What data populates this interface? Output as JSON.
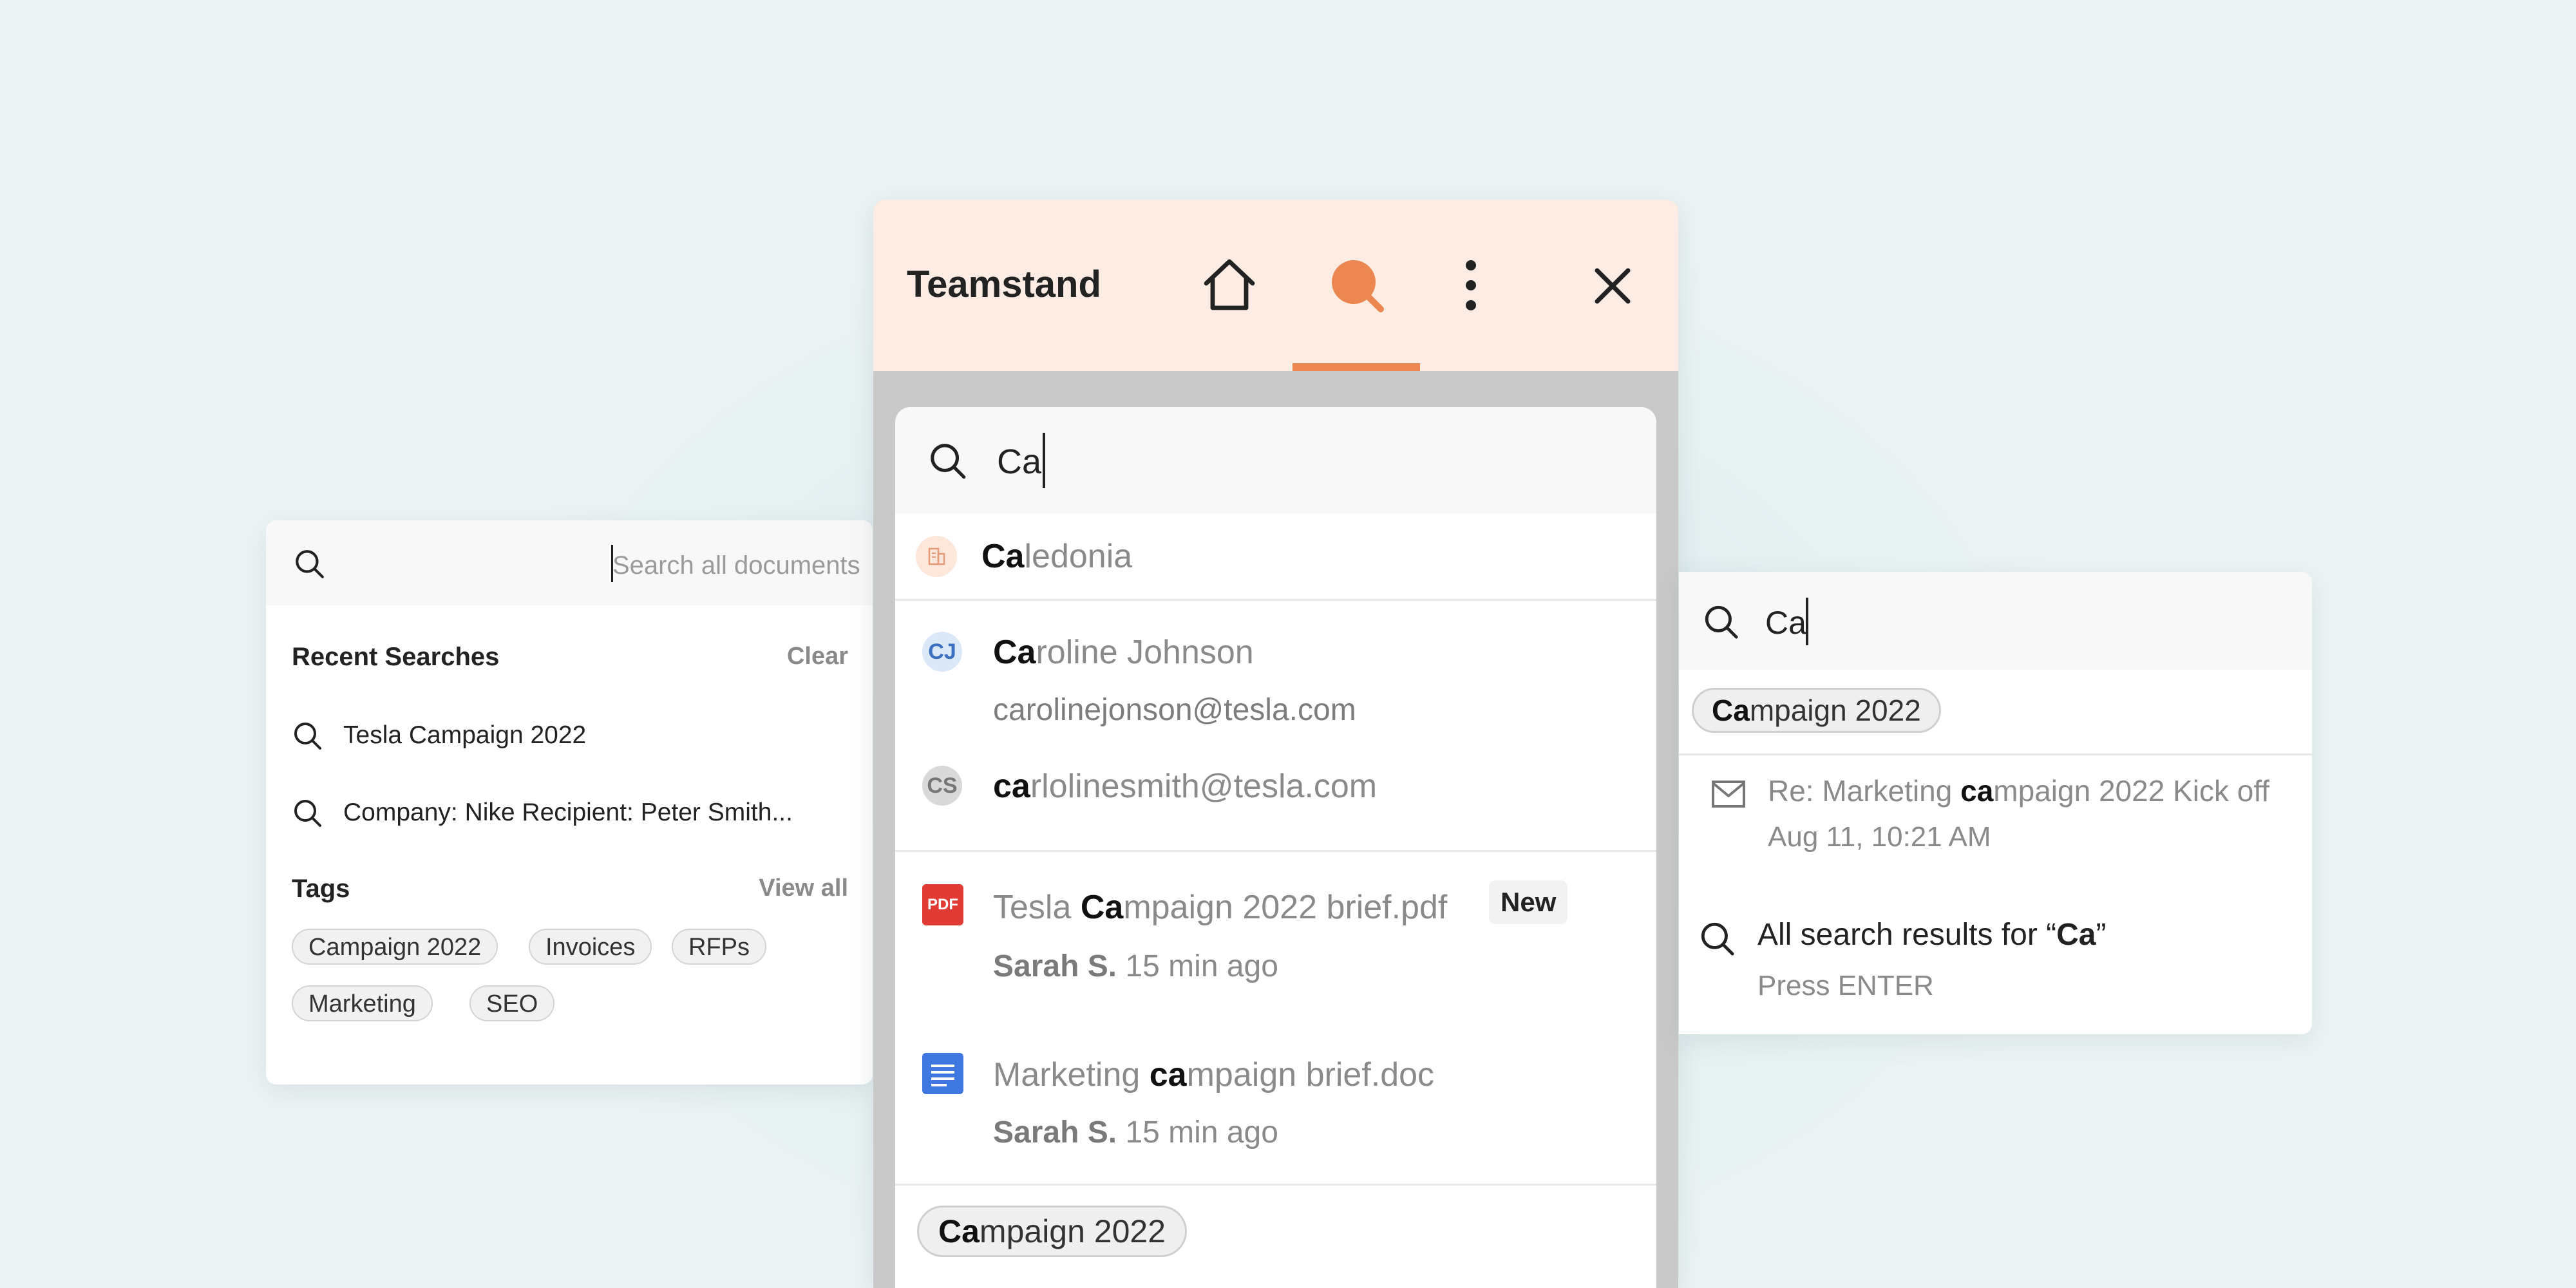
{
  "left_panel": {
    "search_placeholder": "Search all documents",
    "recent_title": "Recent Searches",
    "clear_label": "Clear",
    "recent_items": [
      {
        "icon": "search-icon",
        "text": "Tesla Campaign 2022"
      },
      {
        "icon": "search-icon",
        "text": "Company: Nike Recipient: Peter Smith..."
      }
    ],
    "tags_title": "Tags",
    "view_all_label": "View all",
    "tags": [
      "Campaign 2022",
      "Invoices",
      "RFPs",
      "Marketing",
      "SEO"
    ]
  },
  "main_panel": {
    "app_title": "Teamstand",
    "nav_icons": [
      "home-icon",
      "search-icon",
      "more-vertical-icon",
      "close-icon"
    ],
    "active_tab": "search",
    "search_query": "Ca",
    "results": {
      "company": {
        "match": "Ca",
        "rest": "ledonia",
        "icon": "building-icon"
      },
      "person_1": {
        "initials": "CJ",
        "match": "Ca",
        "rest": "roline Johnson",
        "email": "carolinejonson@tesla.com"
      },
      "person_2": {
        "initials": "CS",
        "match": "ca",
        "rest": "rlolinesmith@tesla.com"
      },
      "file_1": {
        "icon": "pdf-icon",
        "icon_label": "PDF",
        "prefix": "Tesla ",
        "match": "Ca",
        "rest": "mpaign 2022 brief.pdf",
        "badge": "New",
        "author": "Sarah S.",
        "time": "15 min ago"
      },
      "file_2": {
        "icon": "doc-icon",
        "prefix": "Marketing ",
        "match": "ca",
        "rest": "mpaign brief.doc",
        "author": "Sarah S.",
        "time": "15 min ago"
      },
      "tag": {
        "match": "Ca",
        "rest": "mpaign 2022"
      }
    },
    "colors": {
      "accent": "#ec8752",
      "header_bg": "#fcece3"
    }
  },
  "right_panel": {
    "search_query": "Ca",
    "tag": {
      "match": "Ca",
      "rest": "mpaign 2022"
    },
    "email": {
      "icon": "mail-icon",
      "prefix": "Re: Marketing ",
      "match": "ca",
      "rest": "mpaign 2022 Kick off",
      "date": "Aug 11, 10:21 AM"
    },
    "all_results": {
      "icon": "search-icon",
      "prefix": "All search results for “",
      "query": "Ca",
      "suffix": "”",
      "hint": "Press ENTER"
    }
  }
}
